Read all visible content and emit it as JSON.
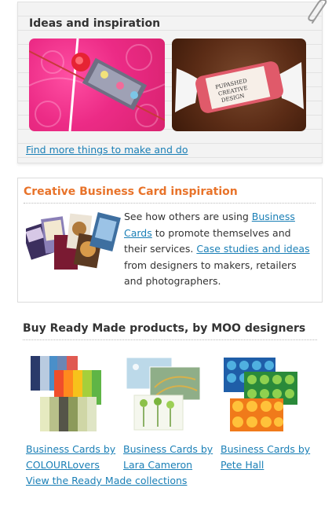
{
  "ideas": {
    "title": "Ideas and inspiration",
    "link": "Find more things to make and do"
  },
  "creative": {
    "title": "Creative Business Card inspiration",
    "text_1": "See how others are using ",
    "link_1": "Business Cards",
    "text_2": " to promote themselves and their services. ",
    "link_2": "Case studies and ideas",
    "text_3": " from designers to makers, retailers and photographers."
  },
  "ready": {
    "title": "Buy Ready Made products, by MOO designers",
    "products": [
      {
        "line1": "Business Cards by",
        "line2": "COLOURLovers"
      },
      {
        "line1": "Business Cards by",
        "line2": "Lara Cameron"
      },
      {
        "line1": "Business Cards by",
        "line2": "Pete Hall"
      }
    ],
    "collections_link": "View the Ready Made collections"
  },
  "colors": {
    "heading_orange": "#e8732a",
    "link_blue": "#1a7fb6"
  },
  "icons": [
    "paperclip-icon"
  ]
}
